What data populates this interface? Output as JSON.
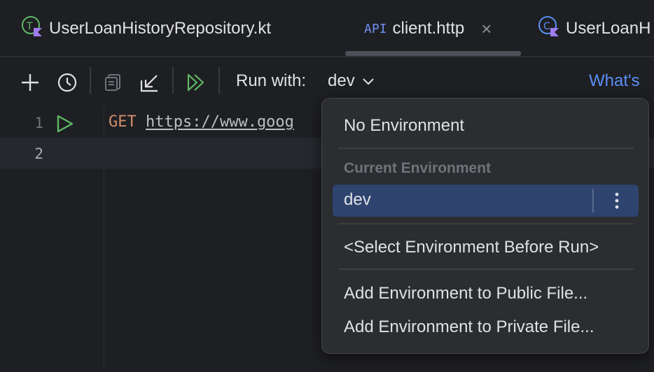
{
  "tabs": [
    {
      "label": "UserLoanHistoryRepository.kt",
      "icon": "kotlin-test-file-icon",
      "active": false
    },
    {
      "badge": "API",
      "label": "client.http",
      "icon": "api-file-icon",
      "active": true,
      "close": "×"
    },
    {
      "label": "UserLoanH",
      "icon": "kotlin-class-file-icon",
      "active": false
    }
  ],
  "toolbar": {
    "run_with_label": "Run with:",
    "env_value": "dev",
    "whats_new": "What's"
  },
  "editor": {
    "lines": [
      {
        "number": "1",
        "method": "GET",
        "url": "https://www.goog"
      },
      {
        "number": "2"
      }
    ]
  },
  "env_menu": {
    "no_environment": "No Environment",
    "section_header": "Current Environment",
    "selected": "dev",
    "select_before_run": "<Select Environment Before Run>",
    "add_public": "Add Environment to Public File...",
    "add_private": "Add Environment to Private File..."
  },
  "colors": {
    "accent": "#5a8ff5",
    "selection": "#2e436e",
    "run_green": "#5fb865",
    "kotlin_purple": "#a07cf0"
  }
}
